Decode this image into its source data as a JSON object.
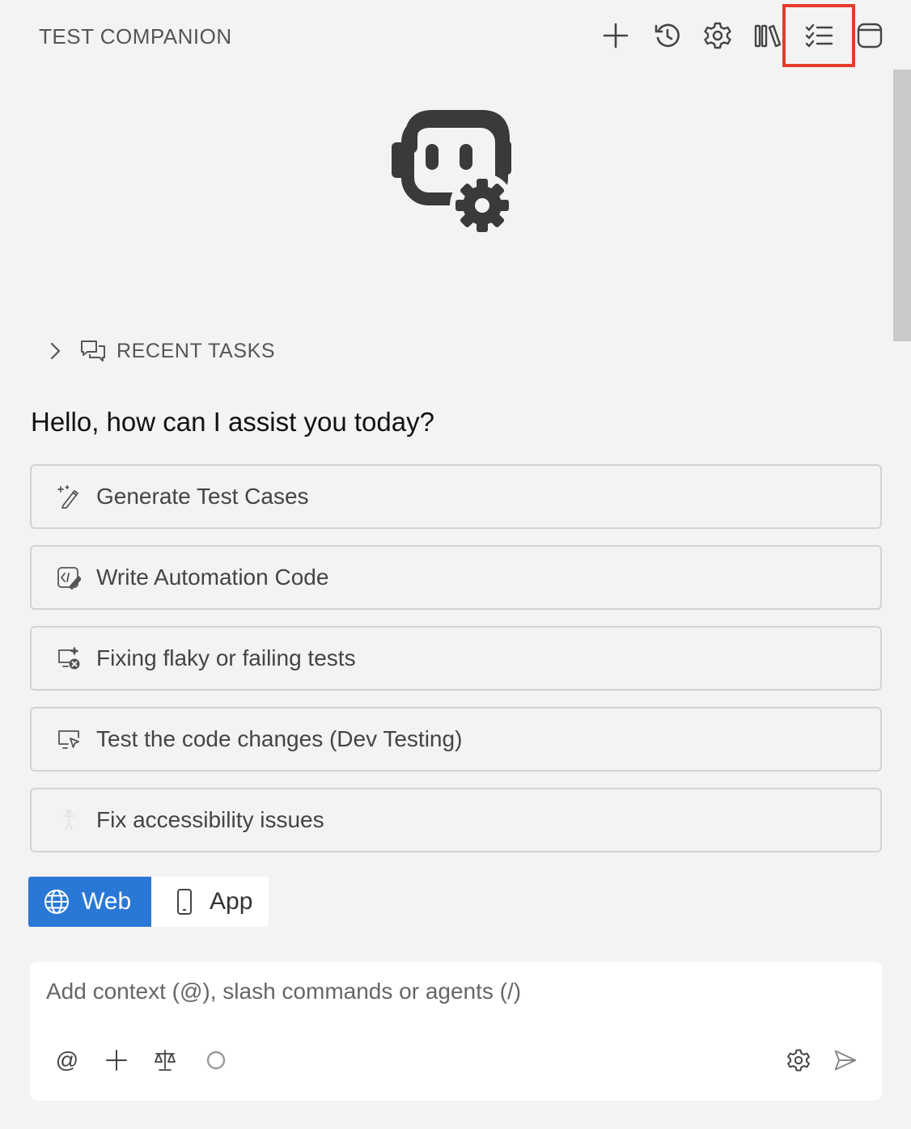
{
  "header": {
    "title": "TEST COMPANION",
    "toolbar": [
      {
        "name": "new-task-button",
        "icon": "plus-icon"
      },
      {
        "name": "history-button",
        "icon": "history-icon"
      },
      {
        "name": "settings-button",
        "icon": "gear-icon"
      },
      {
        "name": "library-button",
        "icon": "library-icon"
      },
      {
        "name": "checklist-button",
        "icon": "checklist-icon"
      },
      {
        "name": "window-button",
        "icon": "window-icon"
      }
    ]
  },
  "recent_tasks": {
    "label": "RECENT TASKS"
  },
  "greeting": "Hello, how can I assist you today?",
  "tasks": [
    {
      "label": "Generate Test Cases",
      "icon": "magic-pen-icon"
    },
    {
      "label": "Write Automation Code",
      "icon": "code-edit-icon"
    },
    {
      "label": "Fixing flaky or failing tests",
      "icon": "screen-error-icon"
    },
    {
      "label": "Test the code changes (Dev Testing)",
      "icon": "screen-cursor-icon"
    },
    {
      "label": "Fix accessibility issues",
      "icon": "accessibility-icon"
    }
  ],
  "platform": {
    "web_label": "Web",
    "app_label": "App",
    "selected": "Web"
  },
  "composer": {
    "placeholder": "Add context (@), slash commands or agents (/)",
    "at_symbol": "@"
  },
  "colors": {
    "accent": "#2a78d6",
    "highlight": "#e53b2c",
    "background": "#f3f3f3"
  }
}
